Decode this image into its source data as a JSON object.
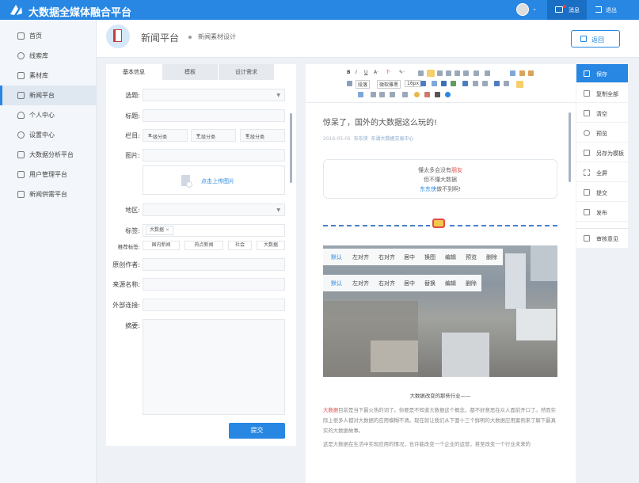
{
  "app": {
    "title": "大数据全媒体融合平台",
    "messages": "消息",
    "logout": "退出"
  },
  "sidebar": {
    "items": [
      "首页",
      "线索库",
      "素材库",
      "新闻平台",
      "个人中心",
      "设置中心",
      "大数据分析平台",
      "用户管理平台",
      "新闻供需平台"
    ],
    "active": "新闻平台"
  },
  "header": {
    "title": "新闻平台",
    "subtitle": "新闻素材设计",
    "back": "返回"
  },
  "form": {
    "tabs": [
      "基本信息",
      "模板",
      "设计需求"
    ],
    "topic_label": "选题:",
    "title_label": "标题:",
    "column_label": "栏目:",
    "columns": [
      "一级分类",
      "二级分类",
      "三级分类"
    ],
    "image_label": "图片:",
    "upload": "点击上传图片",
    "region_label": "地区:",
    "tags_label": "标签:",
    "tag": "大数据",
    "tag_remove": "×",
    "recommend_label": "推荐标签:",
    "recommend_tags": [
      "国内新闻",
      "热点新闻",
      "社会",
      "大数据"
    ],
    "author_label": "原创作者:",
    "source_label": "来源名称:",
    "link_label": "外部连接:",
    "summary_label": "摘要:",
    "submit": "提交"
  },
  "editor": {
    "toolbar_row1": [
      "B",
      "I",
      "U",
      "A·",
      "T·",
      "✎·"
    ],
    "toolbar_row2": [
      "段落",
      "微软雅黑",
      "16px"
    ],
    "article_title": "惊呆了，国外的大数据这么玩的!",
    "date": "2016-05-05",
    "author": "东东侠",
    "org": "东湖大数据交易中心",
    "quote": {
      "l1a": "懂太多会没有",
      "l1b": "朋友",
      "l2": "但不懂大数据",
      "l3a": "东东侠",
      "l3b": "做不到啊!"
    },
    "image_toolbar": [
      "默认",
      "左对齐",
      "右对齐",
      "居中",
      "换图",
      "编辑",
      "预览",
      "删除"
    ],
    "image_toolbar2": [
      "默认",
      "左对齐",
      "右对齐",
      "居中",
      "替换",
      "编辑",
      "删除"
    ],
    "section_title": "大数据改变的那些行业——",
    "p1_red": "大数据",
    "p1": "目前是当下最火热的词了。你要是不知道大数据这个概念，都不好意思在众人面前开口了。然而实际上很多人都对大数据的应用模糊不清。现在就让我们从下面十三个鲜明的大数据应用案例来了解下最真实的大数据故事。",
    "p2": "这是大数据在生活中实现应用的情况，也许能改变一个企业的运营，甚至改变一个行业未来的"
  },
  "actions": [
    "保存",
    "复制全部",
    "清空",
    "预览",
    "另存为模板",
    "全屏",
    "提交",
    "发布"
  ],
  "review": "审核意见",
  "colors": {
    "primary": "#2787e3",
    "accent_red": "#e04b4b"
  }
}
